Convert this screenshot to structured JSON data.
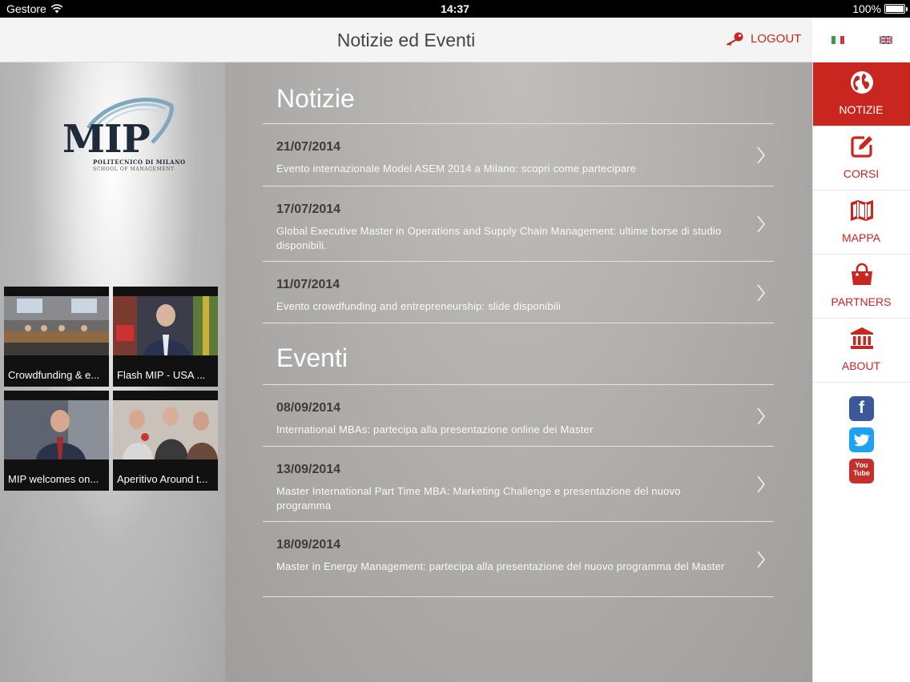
{
  "status_bar": {
    "carrier": "Gestore",
    "time": "14:37",
    "battery": "100%"
  },
  "header": {
    "title": "Notizie ed Eventi",
    "logout_label": "LOGOUT"
  },
  "logo": {
    "name": "MIP",
    "line1": "POLITECNICO DI MILANO",
    "line2": "SCHOOL OF MANAGEMENT"
  },
  "videos": [
    {
      "caption": "Crowdfunding & e..."
    },
    {
      "caption": "Flash MIP - USA ..."
    },
    {
      "caption": "MIP welcomes on..."
    },
    {
      "caption": "Aperitivo Around t..."
    }
  ],
  "news": {
    "title": "Notizie",
    "items": [
      {
        "date": "21/07/2014",
        "text": "Evento internazionale Model ASEM 2014 a Milano: scopri come partecipare"
      },
      {
        "date": "17/07/2014",
        "text": "Global Executive Master in Operations and Supply Chain Management: ultime borse di studio disponibili."
      },
      {
        "date": "11/07/2014",
        "text": "Evento crowdfunding and entrepreneurship: slide disponibili"
      }
    ]
  },
  "events": {
    "title": "Eventi",
    "items": [
      {
        "date": "08/09/2014",
        "text": "International MBAs: partecipa alla presentazione online dei Master"
      },
      {
        "date": "13/09/2014",
        "text": "Master International Part Time MBA: Marketing Challenge e presentazione del nuovo programma"
      },
      {
        "date": "18/09/2014",
        "text": "Master in Energy Management: partecipa alla presentazione del nuovo programma del Master"
      }
    ]
  },
  "nav": {
    "items": [
      {
        "label": "NOTIZIE",
        "icon": "globe-icon",
        "active": true
      },
      {
        "label": "CORSI",
        "icon": "edit-icon"
      },
      {
        "label": "MAPPA",
        "icon": "map-icon"
      },
      {
        "label": "PARTNERS",
        "icon": "shopping-bag-icon"
      },
      {
        "label": "ABOUT",
        "icon": "institution-icon"
      }
    ]
  },
  "social": [
    {
      "name": "facebook-icon",
      "glyph": "f",
      "color": "#3b5998"
    },
    {
      "name": "twitter-icon",
      "color": "#1da1f2"
    },
    {
      "name": "youtube-icon",
      "glyph": "You Tube",
      "color": "#c4302b"
    }
  ],
  "colors": {
    "accent": "#c8261f",
    "nav_active_bg": "#c8261f"
  }
}
